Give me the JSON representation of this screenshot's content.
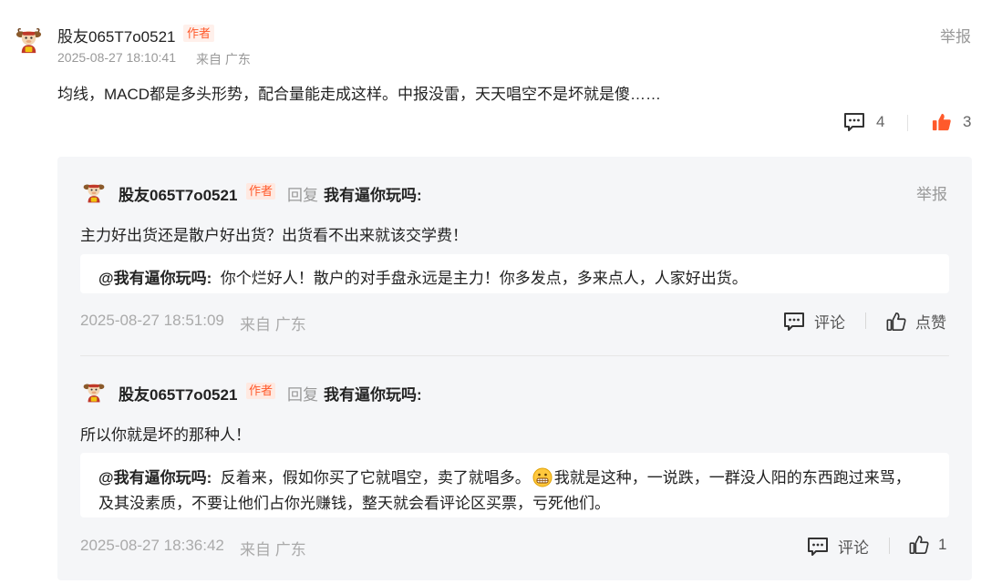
{
  "comment": {
    "user": "股友065T7o0521",
    "badge": "作者",
    "time": "2025-08-27 18:10:41",
    "location": "来自 广东",
    "report": "举报",
    "text": "均线，MACD都是多头形势，配合量能走成这样。中报没雷，天天唱空不是坏就是傻……",
    "reply_count": "4",
    "like_count": "3"
  },
  "replies": [
    {
      "user": "股友065T7o0521",
      "badge": "作者",
      "reply_word": "回复",
      "target": "我有逼你玩吗:",
      "report": "举报",
      "text": "主力好出货还是散户好出货？出货看不出来就该交学费！",
      "quote_user": "@我有逼你玩吗:",
      "quote_line1": "你个烂好人！散户的对手盘永远是主力！你多发点，多来点人，人家好出货。",
      "time": "2025-08-27 18:51:09",
      "location": "来自 广东",
      "comment_label": "评论",
      "like_label": "点赞"
    },
    {
      "user": "股友065T7o0521",
      "badge": "作者",
      "reply_word": "回复",
      "target": "我有逼你玩吗:",
      "text": "所以你就是坏的那种人！",
      "quote_user": "@我有逼你玩吗:",
      "quote_line1a": "反着来，假如你买了它就唱空，卖了就唱多。",
      "quote_line1b": "我就是这种，一说跌，一群没人阳的东西跑过来骂，",
      "quote_line2": "及其没素质，不要让他们占你光赚钱，整天就会看评论区买票，亏死他们。",
      "time": "2025-08-27 18:36:42",
      "location": "来自 广东",
      "comment_label": "评论",
      "like_count": "1"
    }
  ],
  "colors": {
    "accent_orange": "#ff5a2b",
    "panel_bg": "#f5f6f8",
    "muted": "#999999"
  }
}
